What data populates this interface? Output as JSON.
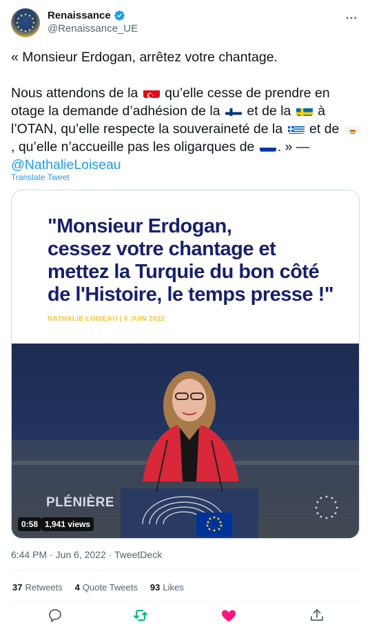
{
  "account": {
    "display_name": "Renaissance",
    "handle": "@Renaissance_UE",
    "verified_icon": "verified-badge-icon",
    "more_icon": "more-options-icon"
  },
  "tweet": {
    "line1": "« Monsieur Erdogan, arrêtez votre chantage.",
    "p2_a": "Nous attendons de la ",
    "p2_b": " qu’elle cesse de prendre en otage la demande d’adhésion de la ",
    "p2_c": " et de la ",
    "p2_d": " à l’OTAN, qu’elle respecte la souveraineté de la ",
    "p2_e": " et de ",
    "p2_f": ", qu’elle n’accueille pas les oligarques de ",
    "p2_g": ". » — ",
    "mention": "@NathalieLoiseau",
    "translate": "Translate Tweet"
  },
  "media": {
    "quote_lines": [
      "\"Monsieur Erdogan,",
      "cessez votre chantage et",
      "mettez la Turquie du bon côté",
      "de l'Histoire, le temps presse !\""
    ],
    "credit": "NATHALIE LOISEAU | 6 JUIN 2022",
    "overlay_label": "PLÉNIÈRE",
    "duration": "0:58",
    "views": "1,941 views"
  },
  "meta": {
    "timestamp": "6:44 PM · Jun 6, 2022 · TweetDeck"
  },
  "stats": {
    "retweets_count": "37",
    "retweets_label": "Retweets",
    "quotes_count": "4",
    "quotes_label": "Quote Tweets",
    "likes_count": "93",
    "likes_label": "Likes"
  },
  "colors": {
    "accent": "#1d9bf0",
    "retweet": "#00ba7c",
    "like": "#f91880",
    "quote_text": "#18206b",
    "credit": "#f3c53b"
  }
}
